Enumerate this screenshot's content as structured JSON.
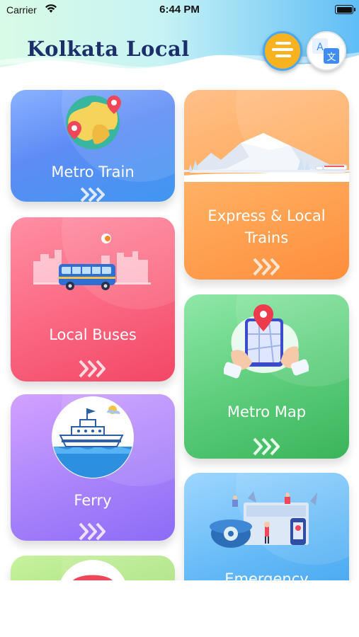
{
  "status_bar": {
    "carrier": "Carrier",
    "time": "6:44 PM",
    "wifi_icon": "wifi-icon",
    "battery_icon": "battery-icon"
  },
  "header": {
    "title": "Kolkata Local",
    "menu_icon": "hamburger-menu-icon",
    "language_icon": "translate-icon",
    "language_glyphs": [
      "A",
      "文"
    ]
  },
  "cards": {
    "metro_train": {
      "label": "Metro Train",
      "icon": "map-pin-globe-icon"
    },
    "express_local": {
      "label_line1": "Express & Local",
      "label_line2": "Trains",
      "icon": "mountain-train-illustration"
    },
    "local_buses": {
      "label": "Local Buses",
      "icon": "city-bus-illustration"
    },
    "metro_map": {
      "label": "Metro Map",
      "icon": "hands-holding-map-illustration"
    },
    "ferry": {
      "label": "Ferry",
      "icon": "boat-illustration"
    },
    "emergency": {
      "label": "Emergency",
      "icon": "emergency-phone-illustration"
    },
    "sixth": {
      "icon": "partial-illustration"
    }
  },
  "colors": {
    "title": "#1d2f6b",
    "metro_card": "#5e8cf5",
    "express_card": "#ffaa5b",
    "buses_card": "#fb6a83",
    "map_card": "#5fcf7d",
    "ferry_card": "#ad86fb",
    "emergency_card": "#62b9f6",
    "sixth_card": "#a6e17a",
    "menu_button": "#f6b21f"
  }
}
